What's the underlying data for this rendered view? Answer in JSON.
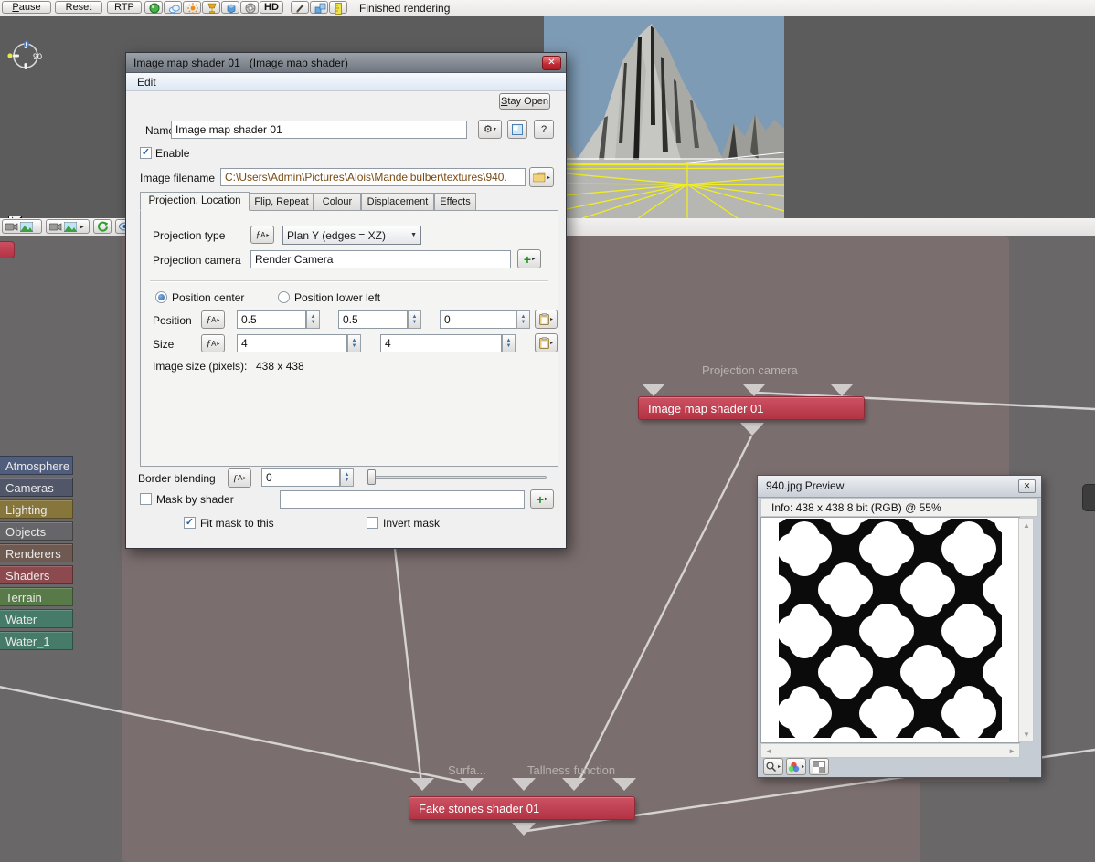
{
  "toolbar": {
    "pause": "Pause",
    "reset": "Reset",
    "rtp": "RTP",
    "hd": "HD",
    "status": "Finished rendering"
  },
  "dialog": {
    "title": "Image map shader 01",
    "subtitle": "(Image map shader)",
    "menu_edit": "Edit",
    "stay_open": "Stay Open",
    "name_label": "Name",
    "name_value": "Image map shader 01",
    "enable_label": "Enable",
    "filename_label": "Image filename",
    "filename_value": "C:\\Users\\Admin\\Pictures\\Alois\\Mandelbulber\\textures\\940.",
    "tabs": [
      {
        "label": "Projection, Location"
      },
      {
        "label": "Flip, Repeat"
      },
      {
        "label": "Colour"
      },
      {
        "label": "Displacement"
      },
      {
        "label": "Effects"
      }
    ],
    "projection_type_label": "Projection type",
    "projection_type_value": "Plan Y (edges = XZ)",
    "projection_camera_label": "Projection camera",
    "projection_camera_value": "Render Camera",
    "position_center_label": "Position center",
    "position_lower_left_label": "Position lower left",
    "position_label": "Position",
    "position_x": "0.5",
    "position_y": "0.5",
    "position_z": "0",
    "size_label": "Size",
    "size_x": "4",
    "size_y": "4",
    "image_size_label": "Image size (pixels):",
    "image_size_value": "438 x 438",
    "border_blending_label": "Border blending",
    "border_blending_value": "0",
    "mask_by_shader_label": "Mask by shader",
    "mask_value": "",
    "fit_mask_label": "Fit mask to this",
    "invert_mask_label": "Invert mask"
  },
  "sidebar": {
    "items": [
      {
        "label": "Atmosphere",
        "color": "#505d7c"
      },
      {
        "label": "Cameras",
        "color": "#515668"
      },
      {
        "label": "Lighting",
        "color": "#87763c"
      },
      {
        "label": "Objects",
        "color": "#66666a"
      },
      {
        "label": "Renderers",
        "color": "#6f5a51"
      },
      {
        "label": "Shaders",
        "color": "#8d4a4e"
      },
      {
        "label": "Terrain",
        "color": "#587a49"
      },
      {
        "label": "Water",
        "color": "#467a69"
      },
      {
        "label": "Water_1",
        "color": "#467a69"
      }
    ]
  },
  "nodes": {
    "image_map_label": "Image map shader 01",
    "fake_stones_label": "Fake stones shader 01",
    "projection_camera_caption": "Projection camera",
    "surface_caption": "Surfa...",
    "tallness_caption": "Tallness function",
    "node_color": "#bf3a4c",
    "pane_color": "#7b6e6e"
  },
  "preview": {
    "title": "940.jpg Preview",
    "info": "Info: 438 x 438 8 bit (RGB)  @ 55%"
  }
}
